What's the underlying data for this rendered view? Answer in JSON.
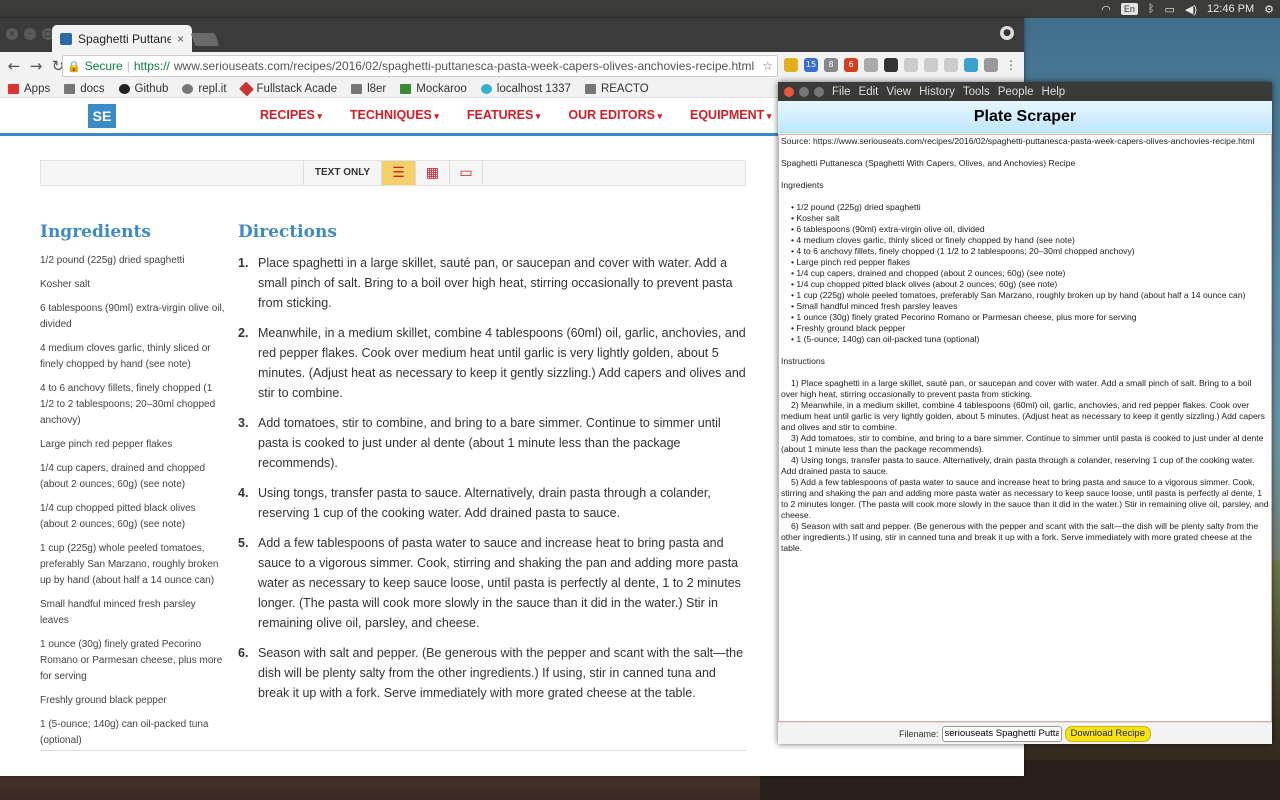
{
  "topbar": {
    "lang": "En",
    "time": "12:46 PM"
  },
  "browser": {
    "tab_title": "Spaghetti Puttanes",
    "tab_close": "×",
    "secure_label": "Secure",
    "url_scheme": "https://",
    "url_rest": "www.seriouseats.com/recipes/2016/02/spaghetti-puttanesca-pasta-week-capers-olives-anchovies-recipe.html",
    "extension_badges": [
      "15",
      "8",
      "6"
    ],
    "bookmarks": [
      "Apps",
      "docs",
      "Github",
      "repl.it",
      "Fullstack Acade",
      "l8er",
      "Mockaroo",
      "localhost 1337",
      "REACTO"
    ]
  },
  "site": {
    "logo": "SE",
    "nav": [
      "RECIPES",
      "TECHNIQUES",
      "FEATURES",
      "OUR EDITORS",
      "EQUIPMENT"
    ],
    "view_label": "TEXT ONLY",
    "ingredients_heading": "Ingredients",
    "directions_heading": "Directions",
    "ingredients": [
      "1/2 pound (225g) dried spaghetti",
      "Kosher salt",
      "6 tablespoons (90ml) extra-virgin olive oil, divided",
      "4 medium cloves garlic, thinly sliced or finely chopped by hand (see note)",
      "4 to 6 anchovy fillets, finely chopped (1 1/2 to 2 tablespoons; 20–30ml chopped anchovy)",
      "Large pinch red pepper flakes",
      "1/4 cup capers, drained and chopped (about 2 ounces; 60g) (see note)",
      "1/4 cup chopped pitted black olives (about 2 ounces; 60g) (see note)",
      "1 cup (225g) whole peeled tomatoes, preferably San Marzano, roughly broken up by hand (about half a 14 ounce can)",
      "Small handful minced fresh parsley leaves",
      "1 ounce (30g) finely grated Pecorino Romano or Parmesan cheese, plus more for serving",
      "Freshly ground black pepper",
      "1 (5-ounce; 140g) can oil-packed tuna (optional)"
    ],
    "directions": [
      "Place spaghetti in a large skillet, sauté pan, or saucepan and cover with water. Add a small pinch of salt. Bring to a boil over high heat, stirring occasionally to prevent pasta from sticking.",
      "Meanwhile, in a medium skillet, combine 4 tablespoons (60ml) oil, garlic, anchovies, and red pepper flakes. Cook over medium heat until garlic is very lightly golden, about 5 minutes. (Adjust heat as necessary to keep it gently sizzling.) Add capers and olives and stir to combine.",
      "Add tomatoes, stir to combine, and bring to a bare simmer. Continue to simmer until pasta is cooked to just under al dente (about 1 minute less than the package recommends).",
      "Using tongs, transfer pasta to sauce. Alternatively, drain pasta through a colander, reserving 1 cup of the cooking water. Add drained pasta to sauce.",
      "Add a few tablespoons of pasta water to sauce and increase heat to bring pasta and sauce to a vigorous simmer. Cook, stirring and shaking the pan and adding more pasta water as necessary to keep sauce loose, until pasta is perfectly al dente, 1 to 2 minutes longer. (The pasta will cook more slowly in the sauce than it did in the water.) Stir in remaining olive oil, parsley, and cheese.",
      "Season with salt and pepper. (Be generous with the pepper and scant with the salt—the dish will be plenty salty from the other ingredients.) If using, stir in canned tuna and break it up with a fork. Serve immediately with more grated cheese at the table."
    ]
  },
  "scraper": {
    "menu": [
      "File",
      "Edit",
      "View",
      "History",
      "Tools",
      "People",
      "Help"
    ],
    "title": "Plate Scraper",
    "source": "Source: https://www.seriouseats.com/recipes/2016/02/spaghetti-puttanesca-pasta-week-capers-olives-anchovies-recipe.html",
    "recipe_title": "Spaghetti Puttanesca (Spaghetti With Capers, Olives, and Anchovies) Recipe",
    "ingredients_label": "Ingredients",
    "ingredients": [
      "• 1/2 pound (225g) dried spaghetti",
      "• Kosher salt",
      "• 6 tablespoons (90ml) extra-virgin olive oil, divided",
      "• 4 medium cloves garlic, thinly sliced or finely chopped by hand (see note)",
      "• 4 to 6 anchovy fillets, finely chopped (1 1/2 to 2 tablespoons; 20–30ml chopped anchovy)",
      "• Large pinch red pepper flakes",
      "• 1/4 cup capers, drained and chopped (about 2 ounces; 60g) (see note)",
      "• 1/4 cup chopped pitted black olives (about 2 ounces; 60g) (see note)",
      "• 1 cup  (225g) whole peeled tomatoes, preferably San Marzano, roughly broken up by hand (about half a 14 ounce can)",
      "• Small handful minced fresh parsley leaves",
      "• 1 ounce (30g) finely grated Pecorino Romano or Parmesan cheese, plus more for serving",
      "• Freshly ground black pepper",
      "• 1 (5-ounce; 140g) can oil-packed tuna (optional)"
    ],
    "instructions_label": "Instructions",
    "instructions": [
      "1) Place spaghetti in a large skillet, sauté pan, or saucepan and cover with water. Add a small pinch of salt. Bring to a boil over high heat, stirring occasionally to prevent pasta from sticking.",
      "2) Meanwhile, in a medium skillet, combine 4 tablespoons (60ml) oil, garlic, anchovies, and red pepper flakes. Cook over medium heat until garlic is very lightly golden, about 5 minutes. (Adjust heat as necessary to keep it gently sizzling.) Add capers and olives and stir to combine.",
      "3) Add tomatoes, stir to combine, and bring to a bare simmer. Continue to simmer until pasta is cooked to just under al dente (about 1 minute less than the package recommends).",
      "4) Using tongs, transfer pasta to sauce. Alternatively, drain pasta through a colander, reserving 1 cup of the cooking water. Add drained pasta to sauce.",
      "5) Add a few tablespoons of pasta water to sauce and increase heat to bring pasta and sauce to a vigorous simmer. Cook, stirring and shaking the pan and adding more pasta water as necessary to keep sauce loose, until pasta is perfectly al dente, 1 to 2 minutes longer. (The pasta will cook more slowly in the sauce than it did in the water.) Stir in remaining olive oil, parsley, and cheese.",
      "6) Season with salt and pepper. (Be generous with the pepper and scant with the salt—the dish will be plenty salty from the other ingredients.) If using, stir in canned tuna and break it up with a fork. Serve immediately with more grated cheese at the table."
    ],
    "filename_label": "Filename:",
    "filename_value": "seriouseats Spaghetti Puttan",
    "download_label": "Download Recipe"
  }
}
